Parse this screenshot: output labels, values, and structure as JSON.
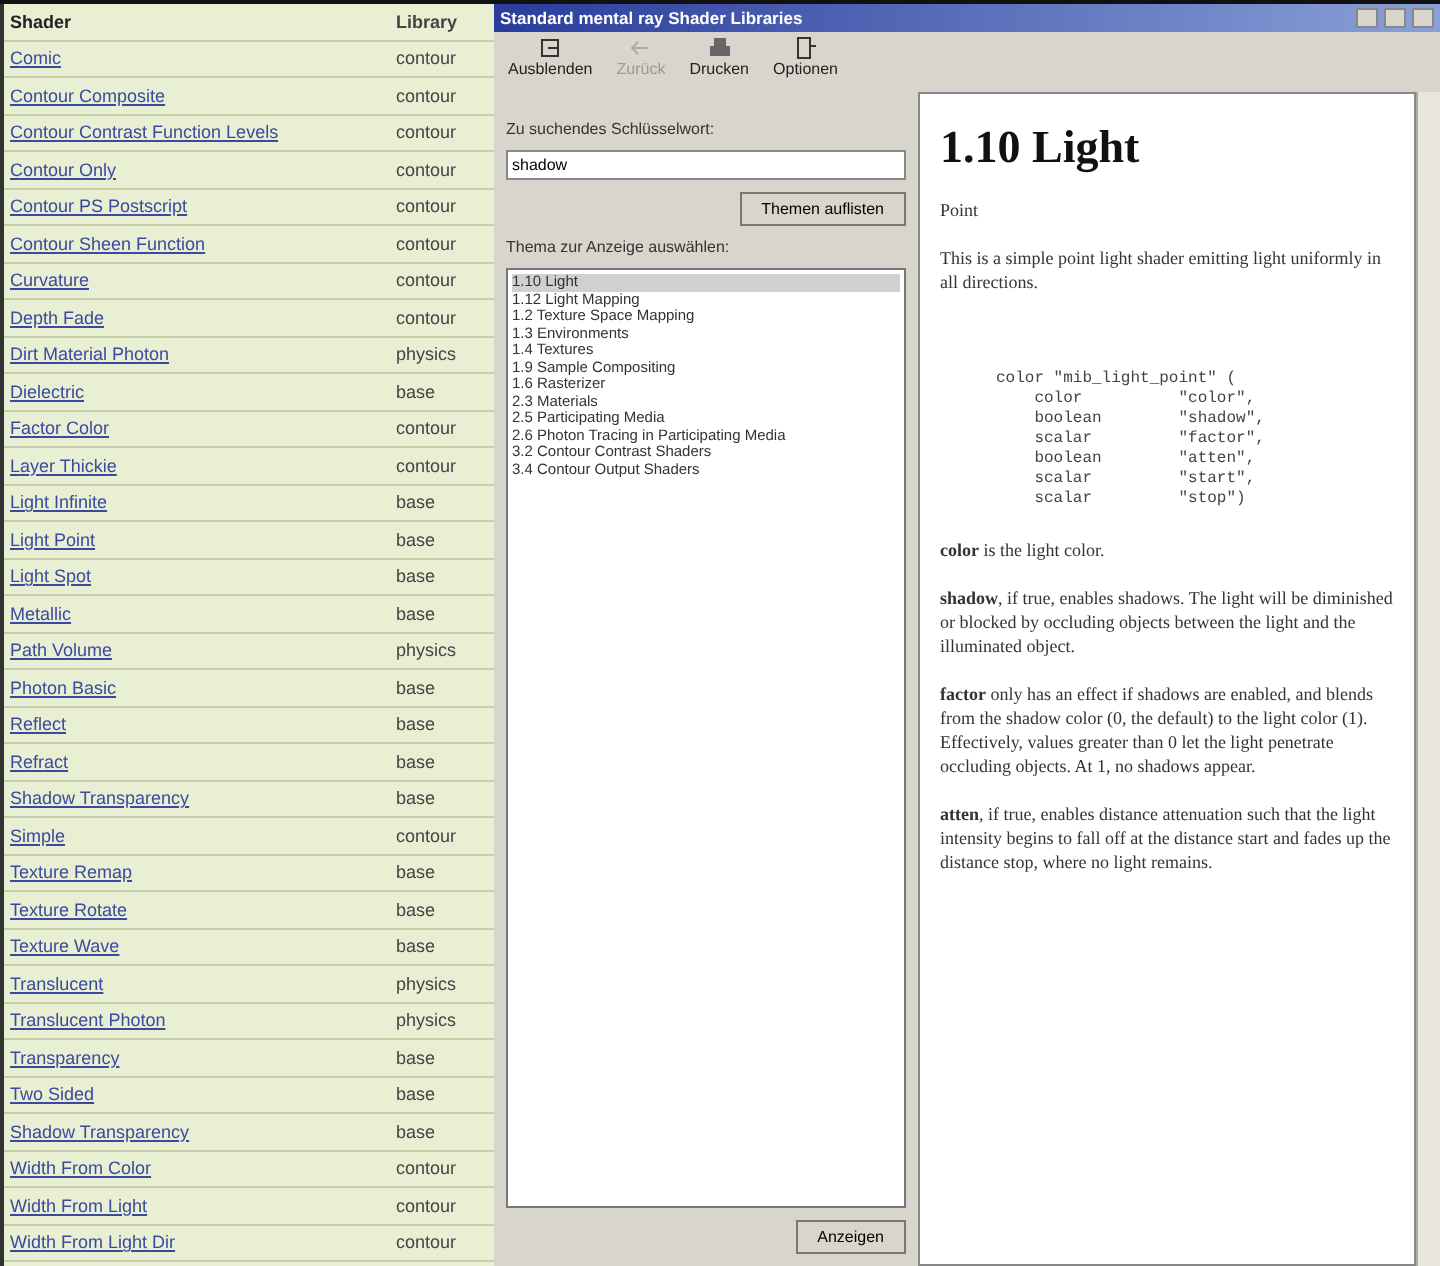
{
  "shader_table": {
    "columns": [
      "Shader",
      "Library"
    ],
    "rows": [
      {
        "shader": "Comic",
        "library": "contour"
      },
      {
        "shader": "Contour Composite",
        "library": "contour"
      },
      {
        "shader": "Contour Contrast Function Levels",
        "library": "contour"
      },
      {
        "shader": "Contour Only",
        "library": "contour"
      },
      {
        "shader": "Contour PS Postscript",
        "library": "contour"
      },
      {
        "shader": "Contour Sheen Function",
        "library": "contour"
      },
      {
        "shader": "Curvature",
        "library": "contour"
      },
      {
        "shader": "Depth Fade",
        "library": "contour"
      },
      {
        "shader": "Dirt Material Photon",
        "library": "physics"
      },
      {
        "shader": "Dielectric",
        "library": "base"
      },
      {
        "shader": "Factor Color",
        "library": "contour"
      },
      {
        "shader": "Layer Thickie",
        "library": "contour"
      },
      {
        "shader": "Light Infinite",
        "library": "base"
      },
      {
        "shader": "Light Point",
        "library": "base"
      },
      {
        "shader": "Light Spot",
        "library": "base"
      },
      {
        "shader": "Metallic",
        "library": "base"
      },
      {
        "shader": "Path Volume",
        "library": "physics"
      },
      {
        "shader": "Photon Basic",
        "library": "base"
      },
      {
        "shader": "Reflect",
        "library": "base"
      },
      {
        "shader": "Refract",
        "library": "base"
      },
      {
        "shader": "Shadow Transparency",
        "library": "base"
      },
      {
        "shader": "Simple",
        "library": "contour"
      },
      {
        "shader": "Texture Remap",
        "library": "base"
      },
      {
        "shader": "Texture Rotate",
        "library": "base"
      },
      {
        "shader": "Texture Wave",
        "library": "base"
      },
      {
        "shader": "Translucent",
        "library": "physics"
      },
      {
        "shader": "Translucent Photon",
        "library": "physics"
      },
      {
        "shader": "Transparency",
        "library": "base"
      },
      {
        "shader": "Two Sided",
        "library": "base"
      },
      {
        "shader": "Shadow Transparency",
        "library": "base"
      },
      {
        "shader": "Width From Color",
        "library": "contour"
      },
      {
        "shader": "Width From Light",
        "library": "contour"
      },
      {
        "shader": "Width From Light Dir",
        "library": "contour"
      }
    ]
  },
  "window": {
    "title": "Standard mental ray Shader Libraries",
    "toolbar": [
      {
        "label": "Ausblenden",
        "kind": "hide",
        "disabled": false
      },
      {
        "label": "Zurück",
        "kind": "back",
        "disabled": true
      },
      {
        "label": "Drucken",
        "kind": "print",
        "disabled": false
      },
      {
        "label": "Optionen",
        "kind": "options",
        "disabled": false
      }
    ]
  },
  "search_pane": {
    "keyword_label": "Zu suchendes Schlüsselwort:",
    "keyword_value": "shadow",
    "list_button": "Themen auflisten",
    "topics_label": "Thema zur Anzeige auswählen:",
    "topics": [
      {
        "label": "1.10 Light",
        "selected": true
      },
      {
        "label": "1.12 Light Mapping",
        "selected": false
      },
      {
        "label": "1.2 Texture Space Mapping",
        "selected": false
      },
      {
        "label": "1.3 Environments",
        "selected": false
      },
      {
        "label": "1.4 Textures",
        "selected": false
      },
      {
        "label": "1.9 Sample Compositing",
        "selected": false
      },
      {
        "label": "1.6 Rasterizer",
        "selected": false
      },
      {
        "label": "2.3 Materials",
        "selected": false
      },
      {
        "label": "2.5 Participating Media",
        "selected": false
      },
      {
        "label": "2.6 Photon Tracing in Participating Media",
        "selected": false
      },
      {
        "label": "3.2 Contour Contrast Shaders",
        "selected": false
      },
      {
        "label": "3.4 Contour Output Shaders",
        "selected": false
      }
    ],
    "show_button": "Anzeigen"
  },
  "content": {
    "heading": "1.10 Light",
    "subheading": "Point",
    "intro": "This is a simple point light shader emitting light uniformly in all directions.",
    "code": [
      "color \"mib_light_point\" (",
      "    color          \"color\",",
      "    boolean        \"shadow\",",
      "    scalar         \"factor\",",
      "    boolean        \"atten\",",
      "    scalar         \"start\",",
      "    scalar         \"stop\")"
    ],
    "paragraphs": [
      "**color** is the light color.",
      "**shadow**, if true, enables shadows. The light will be diminished or blocked by occluding objects between the light and the illuminated object.",
      "**factor** only has an effect if shadows are enabled, and blends from the shadow color (0, the default) to the light color (1). Effectively, values greater than 0 let the light penetrate occluding objects. At 1, no shadows appear.",
      "**atten**, if true, enables distance attenuation such that the light intensity begins to fall off at the distance start and fades up the distance stop, where no light remains."
    ]
  }
}
